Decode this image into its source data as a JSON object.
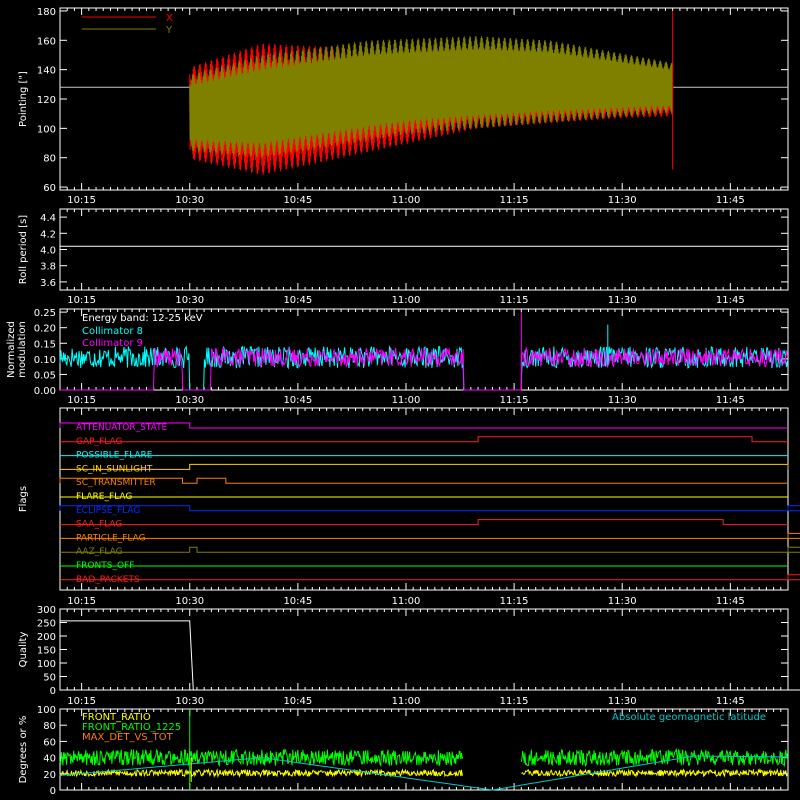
{
  "time_ticks": [
    "10:15",
    "10:30",
    "10:45",
    "11:00",
    "11:15",
    "11:30",
    "11:45"
  ],
  "chart_data": [
    {
      "id": "pointing",
      "type": "line",
      "ylabel": "Pointing [\"]",
      "xlim": [
        "10:12",
        "11:53"
      ],
      "ylim": [
        58,
        182
      ],
      "yticks": [
        60,
        80,
        100,
        120,
        140,
        160,
        180
      ],
      "reference_line": 128,
      "data_interval": [
        "10:30",
        "11:37"
      ],
      "series": [
        {
          "name": "X",
          "color": "#ff0000",
          "upper": [
            [
              629,
              140
            ],
            [
              640,
              158
            ],
            [
              670,
              150
            ],
            [
              690,
              140
            ],
            [
              720,
              150
            ],
            [
              750,
              162
            ],
            [
              790,
              164
            ],
            [
              830,
              162
            ],
            [
              857,
              158
            ]
          ],
          "lower": [
            [
              629,
              80
            ],
            [
              640,
              68
            ],
            [
              670,
              100
            ],
            [
              690,
              107
            ],
            [
              720,
              112
            ],
            [
              750,
              110
            ],
            [
              790,
              108
            ],
            [
              830,
              106
            ],
            [
              857,
              102
            ]
          ]
        },
        {
          "name": "Y",
          "color": "#808000",
          "upper": [
            [
              629,
              135
            ],
            [
              640,
              150
            ],
            [
              655,
              160
            ],
            [
              670,
              163
            ],
            [
              680,
              160
            ],
            [
              700,
              142
            ],
            [
              720,
              138
            ],
            [
              760,
              138
            ],
            [
              857,
              138
            ]
          ],
          "lower": [
            [
              629,
              85
            ],
            [
              640,
              80
            ],
            [
              660,
              96
            ],
            [
              680,
              104
            ],
            [
              700,
              112
            ],
            [
              720,
              118
            ],
            [
              760,
              120
            ],
            [
              857,
              118
            ]
          ]
        }
      ]
    },
    {
      "id": "roll",
      "type": "line",
      "ylabel": "Roll period [s]",
      "xlim": [
        "10:12",
        "11:53"
      ],
      "ylim": [
        3.5,
        4.5
      ],
      "yticks": [
        "3.6",
        "3.8",
        "4.0",
        "4.2",
        "4.4"
      ],
      "series": [
        {
          "color": "#ffffff",
          "values": [
            [
              612,
              4.04
            ],
            [
              713,
              4.04
            ]
          ]
        }
      ]
    },
    {
      "id": "modulation",
      "type": "line",
      "ylabel": [
        "Normalized",
        "modulation"
      ],
      "xlim": [
        "10:12",
        "11:53"
      ],
      "ylim": [
        0,
        0.26
      ],
      "yticks": [
        "0.00",
        "0.05",
        "0.10",
        "0.15",
        "0.20",
        "0.25"
      ],
      "annotation": "Energy band: 12-25 keV",
      "series": [
        {
          "name": "Collimator 8",
          "color": "#00ffff",
          "segments": [
            [
              612,
              630
            ],
            [
              632,
              668
            ],
            [
              676,
              713
            ]
          ],
          "mean": 0.105,
          "noise": 0.035
        },
        {
          "name": "Collimator 9",
          "color": "#ff00ff",
          "segments": [
            [
              625,
              629
            ],
            [
              633,
              668
            ],
            [
              676,
              713
            ]
          ],
          "mean": 0.105,
          "noise": 0.03
        }
      ]
    },
    {
      "id": "flags",
      "type": "line",
      "ylabel": "Flags",
      "xlim": [
        "10:12",
        "11:53"
      ],
      "flags": [
        {
          "name": "ATTENUATOR_STATE",
          "color": "#ff00ff",
          "high": [
            [
              612,
              630
            ]
          ]
        },
        {
          "name": "GAP_FLAG",
          "color": "#ff2020",
          "high": [
            [
              670,
              708
            ]
          ]
        },
        {
          "name": "POSSIBLE_FLARE",
          "color": "#00ffff",
          "high": []
        },
        {
          "name": "SC_IN_SUNLIGHT",
          "color": "#ffd000",
          "high": [
            [
              630,
              716
            ]
          ]
        },
        {
          "name": "SC_TRANSMITTER",
          "color": "#ff7f00",
          "high": [
            [
              612,
              629
            ],
            [
              631,
              635
            ]
          ]
        },
        {
          "name": "FLARE_FLAG",
          "color": "#ffff00",
          "high": []
        },
        {
          "name": "ECLIPSE_FLAG",
          "color": "#0030ff",
          "high": [
            [
              612,
              630
            ],
            [
              716,
              753
            ]
          ]
        },
        {
          "name": "SAA_FLAG",
          "color": "#ff2020",
          "high": [
            [
              670,
              704
            ]
          ]
        },
        {
          "name": "PARTICLE_FLAG",
          "color": "#ff7f00",
          "high": [
            [
              719.5,
              719.9
            ],
            [
              733,
              733.4
            ],
            [
              734.3,
              734.6
            ]
          ]
        },
        {
          "name": "AAZ_FLAG",
          "color": "#808000",
          "high": [
            [
              630,
              631
            ],
            [
              716,
              717
            ]
          ]
        },
        {
          "name": "FRONTS_OFF",
          "color": "#00ff00",
          "high": []
        },
        {
          "name": "BAD_PACKETS",
          "color": "#ff2020",
          "high": [
            [
              749,
              749.4
            ]
          ]
        }
      ]
    },
    {
      "id": "quality",
      "type": "line",
      "ylabel": "Quality",
      "xlim": [
        "10:12",
        "11:53"
      ],
      "ylim": [
        0,
        300
      ],
      "yticks": [
        0,
        50,
        100,
        150,
        200,
        250,
        300
      ],
      "series": [
        {
          "color": "#ffffff",
          "values": [
            [
              612,
              256
            ],
            [
              630,
              256
            ],
            [
              630.5,
              0
            ],
            [
              717,
              0
            ],
            [
              717.3,
              95
            ],
            [
              717.6,
              256
            ],
            [
              753,
              256
            ]
          ]
        }
      ]
    },
    {
      "id": "ratios",
      "type": "line",
      "ylabel": "Degrees or %",
      "xlim": [
        "10:12",
        "11:53"
      ],
      "ylim": [
        0,
        100
      ],
      "yticks": [
        0,
        20,
        40,
        60,
        80,
        100
      ],
      "annotation": "Absolute geomagnetic latitude",
      "series": [
        {
          "name": "FRONT_RATIO",
          "color": "#ffff00",
          "segments": [
            [
              612,
              668
            ],
            [
              676,
              713
            ]
          ],
          "mean": 21,
          "noise": 4
        },
        {
          "name": "FRONT_RATIO_1225",
          "color": "#00ff00",
          "segments": [
            [
              612,
              668
            ],
            [
              676,
              713
            ]
          ],
          "mean": 40,
          "noise": 10
        },
        {
          "name": "MAX_DET_VS_TOT",
          "color": "#ff7f00",
          "segments": [],
          "mean": 0,
          "noise": 0
        },
        {
          "name": "Absolute geomagnetic latitude",
          "color": "#00c8c8",
          "values": [
            [
              612,
              18
            ],
            [
              640,
              40
            ],
            [
              672,
              0
            ],
            [
              700,
              42
            ],
            [
              720,
              40
            ],
            [
              753,
              12
            ]
          ]
        }
      ]
    }
  ]
}
